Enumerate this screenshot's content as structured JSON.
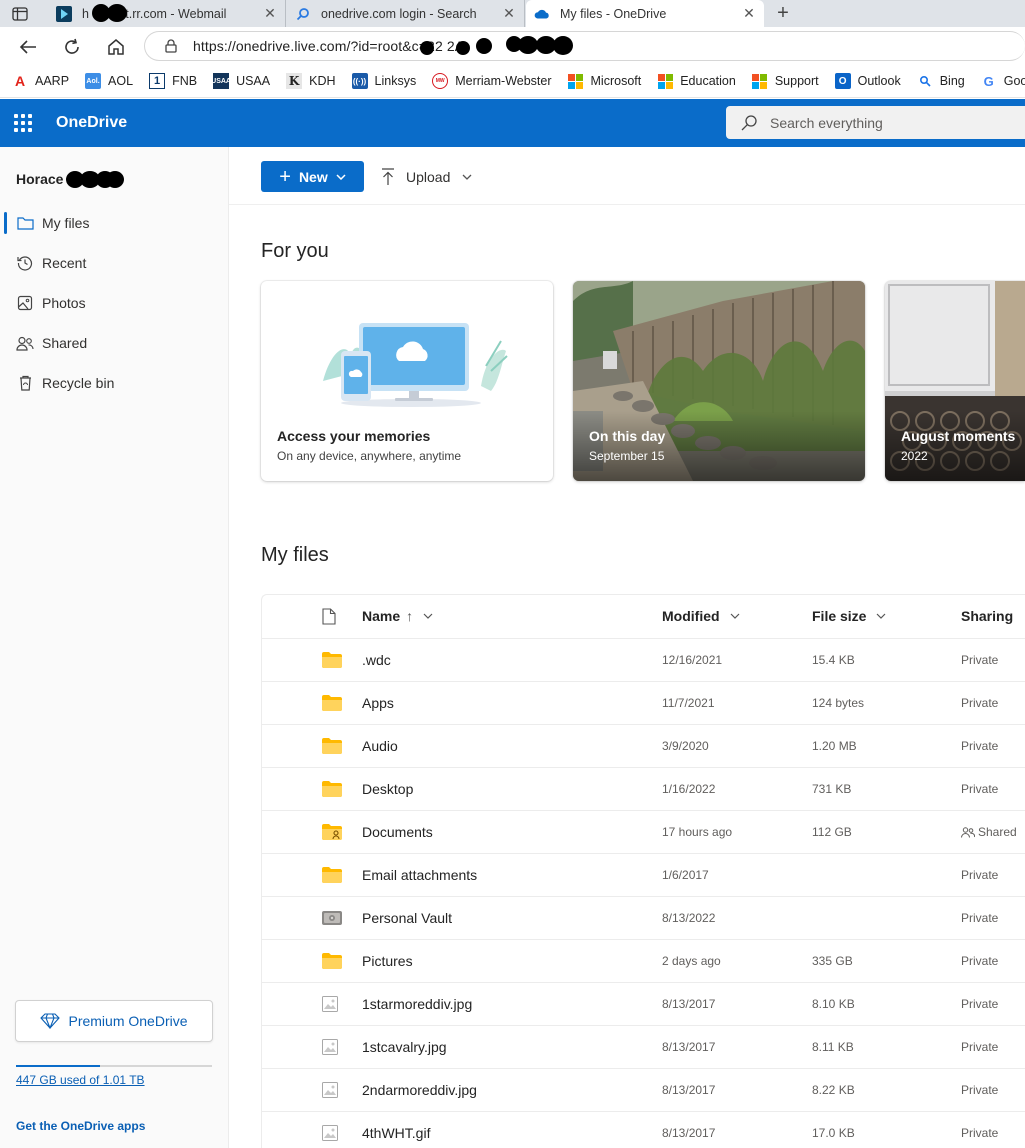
{
  "browser": {
    "tabs": [
      {
        "title": "h        s@hot.rr.com - Webmail",
        "icon": "webmail-icon",
        "active": false
      },
      {
        "title": "onedrive.com login - Search",
        "icon": "search-icon",
        "active": false
      },
      {
        "title": "My files - OneDrive",
        "icon": "onedrive-cloud-icon",
        "active": true
      }
    ],
    "url": "https://onedrive.live.com/?id=root&c",
    "url_rest": "=22      2A",
    "bookmarks": [
      {
        "label": "AARP",
        "icon": "aarp-icon",
        "color": "#e2231a"
      },
      {
        "label": "AOL",
        "icon": "aol-icon",
        "color": "#3d8ee6"
      },
      {
        "label": "FNB",
        "icon": "fnb-icon",
        "color": "#0b3a6b"
      },
      {
        "label": "USAA",
        "icon": "usaa-icon",
        "color": "#12345a"
      },
      {
        "label": "KDH",
        "icon": "kdh-icon",
        "color": "#333333"
      },
      {
        "label": "Linksys",
        "icon": "linksys-icon",
        "color": "#1a5aa8"
      },
      {
        "label": "Merriam-Webster",
        "icon": "merriam-webster-icon",
        "color": "#d71920"
      },
      {
        "label": "Microsoft",
        "icon": "microsoft-icon",
        "color": "#f25022"
      },
      {
        "label": "Education",
        "icon": "microsoft-icon",
        "color": "#f25022"
      },
      {
        "label": "Support",
        "icon": "microsoft-icon",
        "color": "#f25022"
      },
      {
        "label": "Outlook",
        "icon": "outlook-icon",
        "color": "#0a64c8"
      },
      {
        "label": "Bing",
        "icon": "bing-search-icon",
        "color": "#1a73e8"
      },
      {
        "label": "Googl",
        "icon": "google-icon",
        "color": "#4285f4"
      }
    ]
  },
  "header": {
    "brand": "OneDrive",
    "search_placeholder": "Search everything",
    "accent": "#0a6cc9"
  },
  "sidebar": {
    "user_name": "Horace",
    "items": [
      {
        "label": "My files",
        "icon": "folder-icon",
        "selected": true
      },
      {
        "label": "Recent",
        "icon": "history-icon",
        "selected": false
      },
      {
        "label": "Photos",
        "icon": "photo-icon",
        "selected": false
      },
      {
        "label": "Shared",
        "icon": "people-icon",
        "selected": false
      },
      {
        "label": "Recycle bin",
        "icon": "recycle-bin-icon",
        "selected": false
      }
    ],
    "premium_label": "Premium OneDrive",
    "storage_text": "447 GB used of 1.01 TB",
    "storage_fraction": 0.43,
    "get_apps": "Get the OneDrive apps"
  },
  "commands": {
    "new_label": "New",
    "upload_label": "Upload"
  },
  "for_you": {
    "title": "For you",
    "cards": [
      {
        "title": "Access your memories",
        "subtitle": "On any device, anywhere, anytime"
      },
      {
        "title": "On this day",
        "subtitle": "September 15"
      },
      {
        "title": "August moments",
        "subtitle": "2022"
      }
    ]
  },
  "files": {
    "title": "My files",
    "columns": {
      "name": "Name",
      "name_sort": "↑",
      "modified": "Modified",
      "size": "File size",
      "sharing": "Sharing"
    },
    "rows": [
      {
        "name": ".wdc",
        "type": "folder",
        "modified": "12/16/2021",
        "size": "15.4 KB",
        "sharing": "Private"
      },
      {
        "name": "Apps",
        "type": "folder",
        "modified": "11/7/2021",
        "size": "124 bytes",
        "sharing": "Private"
      },
      {
        "name": "Audio",
        "type": "folder",
        "modified": "3/9/2020",
        "size": "1.20 MB",
        "sharing": "Private"
      },
      {
        "name": "Desktop",
        "type": "folder",
        "modified": "1/16/2022",
        "size": "731 KB",
        "sharing": "Private"
      },
      {
        "name": "Documents",
        "type": "shared-folder",
        "modified": "17 hours ago",
        "size": "112 GB",
        "sharing": "Shared"
      },
      {
        "name": "Email attachments",
        "type": "folder",
        "modified": "1/6/2017",
        "size": "",
        "sharing": "Private"
      },
      {
        "name": "Personal Vault",
        "type": "vault",
        "modified": "8/13/2022",
        "size": "",
        "sharing": "Private"
      },
      {
        "name": "Pictures",
        "type": "folder",
        "modified": "2 days ago",
        "size": "335 GB",
        "sharing": "Private"
      },
      {
        "name": "1starmoreddiv.jpg",
        "type": "image",
        "modified": "8/13/2017",
        "size": "8.10 KB",
        "sharing": "Private"
      },
      {
        "name": "1stcavalry.jpg",
        "type": "image",
        "modified": "8/13/2017",
        "size": "8.11 KB",
        "sharing": "Private"
      },
      {
        "name": "2ndarmoreddiv.jpg",
        "type": "image",
        "modified": "8/13/2017",
        "size": "8.22 KB",
        "sharing": "Private"
      },
      {
        "name": "4thWHT.gif",
        "type": "image",
        "modified": "8/13/2017",
        "size": "17.0 KB",
        "sharing": "Private"
      }
    ]
  }
}
